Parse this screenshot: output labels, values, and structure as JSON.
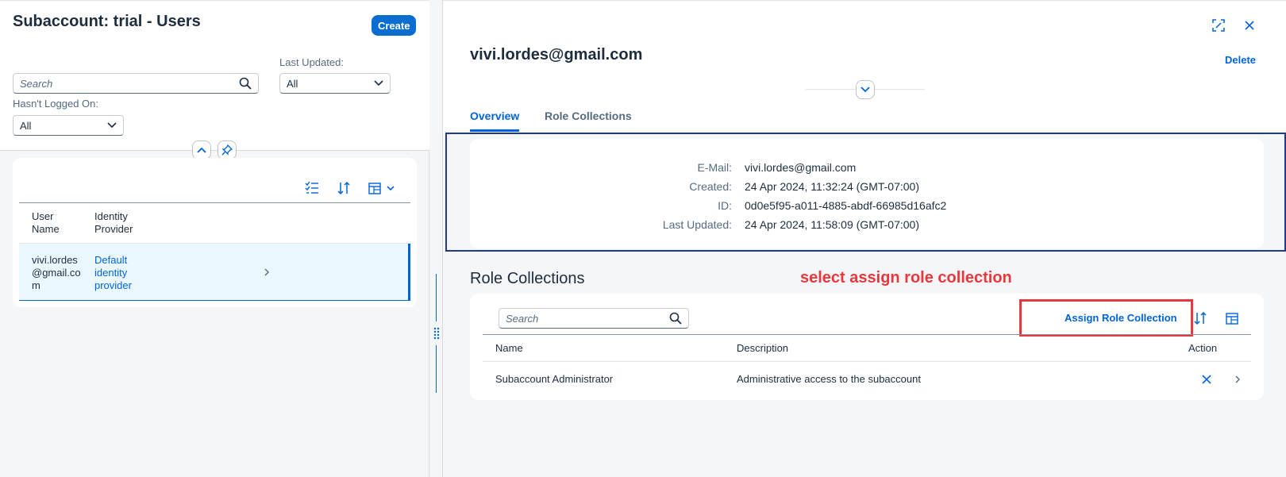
{
  "left": {
    "title": "Subaccount: trial - Users",
    "create_label": "Create",
    "search_placeholder": "Search",
    "filters": {
      "last_updated_label": "Last Updated:",
      "last_updated_value": "All",
      "logged_on_label": "Hasn't Logged On:",
      "logged_on_value": "All"
    },
    "table": {
      "col_user": "User Name",
      "col_idp": "Identity Provider",
      "row": {
        "user": "vivi.lordes@gmail.com",
        "idp": "Default identity provider"
      }
    }
  },
  "right": {
    "title": "vivi.lordes@gmail.com",
    "delete_label": "Delete",
    "tabs": [
      {
        "label": "Overview"
      },
      {
        "label": "Role Collections"
      }
    ],
    "details": [
      {
        "label": "E-Mail:",
        "value": "vivi.lordes@gmail.com"
      },
      {
        "label": "Created:",
        "value": "24 Apr 2024, 11:32:24 (GMT-07:00)"
      },
      {
        "label": "ID:",
        "value": "0d0e5f95-a011-4885-abdf-66985d16afc2"
      },
      {
        "label": "Last Updated:",
        "value": "24 Apr 2024, 11:58:09 (GMT-07:00)"
      }
    ],
    "roles": {
      "section_title": "Role Collections",
      "search_placeholder": "Search",
      "assign_label": "Assign Role Collection",
      "col_name": "Name",
      "col_desc": "Description",
      "col_action": "Action",
      "row": {
        "name": "Subaccount Administrator",
        "desc": "Administrative access to the subaccount"
      }
    },
    "annotation": "select assign role collection"
  },
  "colors": {
    "accent": "#0064d9",
    "annotation": "#e8383d"
  }
}
